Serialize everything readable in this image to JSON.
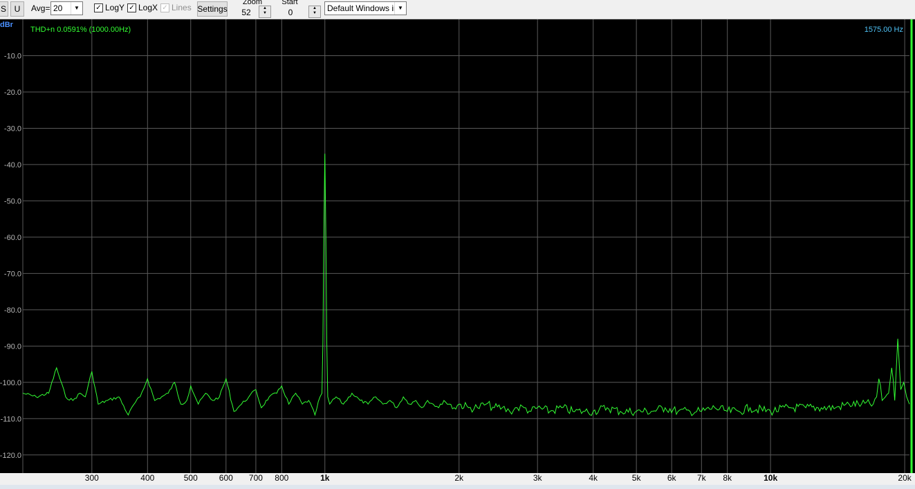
{
  "toolbar": {
    "s_label": "S",
    "u_label": "U",
    "avg_label": "Avg=",
    "avg_value": "20",
    "logy_label": "LogY",
    "logy_checked": true,
    "logx_label": "LogX",
    "logx_checked": true,
    "lines_label": "Lines",
    "lines_checked": true,
    "settings_label": "Settings",
    "zoom_label": "Zoom",
    "zoom_value": "52",
    "start_label": "Start",
    "start_value": "0",
    "input_device": "Default Windows inp"
  },
  "plot": {
    "corner_label": "dBr",
    "thd_text": "THD+n 0.0591% (1000.00Hz)",
    "cursor_text": "1575.00 Hz",
    "colors": {
      "background": "#000000",
      "trace": "#33ff33",
      "grid": "#5a5a5a",
      "y_labels": "#b8b8b8",
      "x_labels": "#000000",
      "thd_text": "#33ff33",
      "cursor_text": "#4fc3f7"
    }
  },
  "chart_data": {
    "type": "line",
    "title": "",
    "xlabel": "",
    "ylabel": "dBr",
    "xscale": "log",
    "xlim": [
      210,
      20500
    ],
    "ylim": [
      -125,
      0
    ],
    "grid": true,
    "y_ticks": [
      -10,
      -20,
      -30,
      -40,
      -50,
      -60,
      -70,
      -80,
      -90,
      -100,
      -110,
      -120
    ],
    "y_tick_labels": [
      "-10.0",
      "-20.0",
      "-30.0",
      "-40.0",
      "-50.0",
      "-60.0",
      "-70.0",
      "-80.0",
      "-90.0",
      "-100.0",
      "-110.0",
      "-120.0"
    ],
    "x_ticks": [
      300,
      400,
      500,
      600,
      700,
      800,
      1000,
      2000,
      3000,
      4000,
      5000,
      6000,
      7000,
      8000,
      10000,
      20000
    ],
    "x_tick_labels": [
      "300",
      "400",
      "500",
      "600",
      "700",
      "800",
      "1k",
      "2k",
      "3k",
      "4k",
      "5k",
      "6k",
      "7k",
      "8k",
      "10k",
      "20k"
    ],
    "x_tick_bold": [
      "1k",
      "10k"
    ],
    "series": [
      {
        "color": "#33ff33",
        "x": [
          210,
          225,
          240,
          250,
          262,
          272,
          282,
          290,
          300,
          310,
          325,
          345,
          362,
          373,
          385,
          400,
          415,
          430,
          445,
          460,
          475,
          490,
          500,
          520,
          540,
          560,
          580,
          600,
          625,
          650,
          675,
          700,
          720,
          750,
          780,
          800,
          830,
          860,
          890,
          920,
          950,
          975,
          985,
          990,
          995,
          1000,
          1005,
          1010,
          1015,
          1025,
          1060,
          1100,
          1150,
          1200,
          1250,
          1300,
          1350,
          1400,
          1450,
          1500,
          1550,
          1600,
          1650,
          1700,
          1750,
          1800,
          1850,
          1900,
          1950,
          2000,
          2100,
          2200,
          2300,
          2400,
          2500,
          2600,
          2700,
          2800,
          2900,
          3000,
          3200,
          3400,
          3600,
          3800,
          4000,
          4300,
          4600,
          5000,
          5400,
          5800,
          6200,
          6600,
          7000,
          7500,
          8000,
          8500,
          9000,
          10000,
          11000,
          12000,
          13000,
          14000,
          15000,
          16000,
          17000,
          17300,
          17500,
          17800,
          18100,
          18400,
          18700,
          19000,
          19300,
          19600,
          19900,
          20200,
          20500
        ],
        "values": [
          -103,
          -104,
          -103,
          -96,
          -104,
          -105,
          -103,
          -104,
          -97,
          -106,
          -105,
          -104,
          -109,
          -106,
          -104,
          -99,
          -105,
          -104,
          -103,
          -100,
          -106,
          -105,
          -101,
          -106,
          -103,
          -105,
          -104,
          -99,
          -108,
          -106,
          -104,
          -102,
          -107,
          -104,
          -103,
          -101,
          -106,
          -103,
          -106,
          -105,
          -109,
          -104,
          -103,
          -89,
          -58,
          -37,
          -58,
          -89,
          -104,
          -106,
          -104,
          -106,
          -103,
          -105,
          -106,
          -104,
          -106,
          -105,
          -107,
          -104,
          -106,
          -105,
          -107,
          -105,
          -106,
          -107,
          -105,
          -106,
          -107,
          -106,
          -107,
          -107,
          -106,
          -107,
          -107,
          -108,
          -107,
          -107,
          -108,
          -107,
          -108,
          -107,
          -108,
          -108,
          -108,
          -107,
          -108,
          -108,
          -108,
          -107,
          -108,
          -108,
          -108,
          -107,
          -108,
          -108,
          -107,
          -108,
          -107,
          -107,
          -107,
          -107,
          -106,
          -106,
          -106,
          -104,
          -99,
          -105,
          -104,
          -103,
          -96,
          -105,
          -88,
          -102,
          -100,
          -104,
          -106
        ]
      }
    ]
  }
}
